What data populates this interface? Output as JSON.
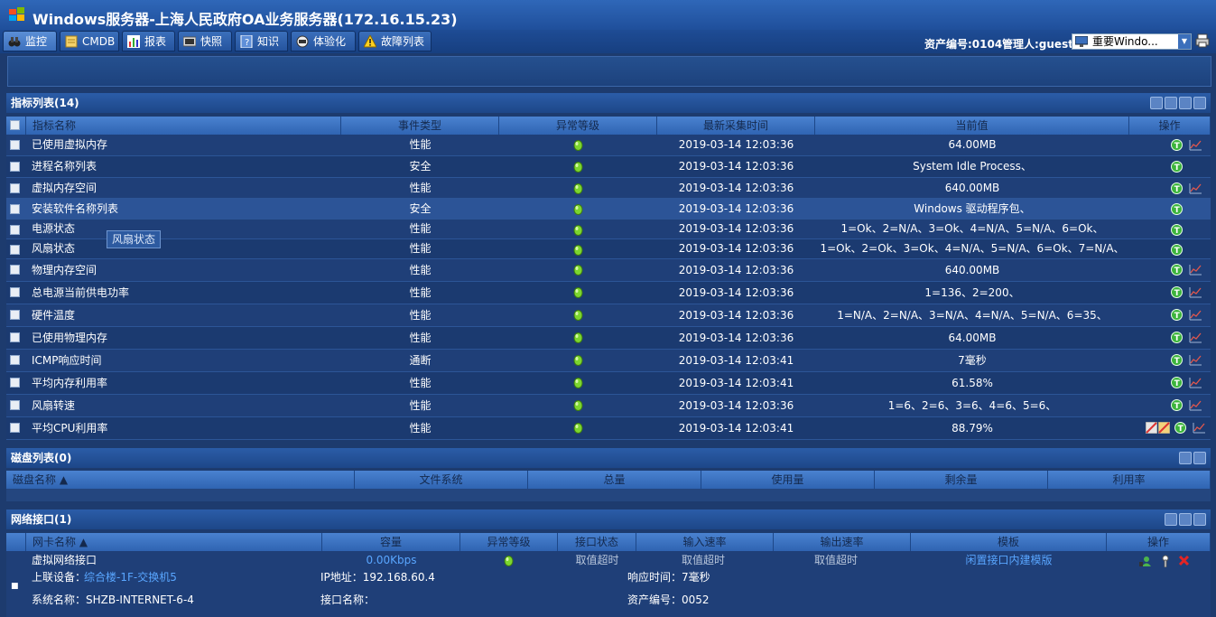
{
  "window": {
    "title": "Windows服务器-上海人民政府OA业务服务器(172.16.15.23)"
  },
  "tabs": [
    {
      "label": "监控",
      "icon": "binoculars-icon",
      "active": true
    },
    {
      "label": "CMDB",
      "icon": "database-icon"
    },
    {
      "label": "报表",
      "icon": "bar-chart-icon"
    },
    {
      "label": "快照",
      "icon": "snapshot-icon"
    },
    {
      "label": "知识",
      "icon": "book-icon"
    },
    {
      "label": "体验化",
      "icon": "globe-icon"
    },
    {
      "label": "故障列表",
      "icon": "warning-icon"
    }
  ],
  "header_meta": {
    "asset_label": "资产编号:0104",
    "manager_label": "管理人:guest",
    "importance_select": "重要Windo..."
  },
  "metrics_panel": {
    "title": "指标列表(14)",
    "columns": [
      "指标名称",
      "事件类型",
      "异常等级",
      "最新采集时间",
      "当前值",
      "操作"
    ],
    "rows": [
      {
        "name": "已使用虚拟内存",
        "type": "性能",
        "time": "2019-03-14 12:03:36",
        "value": "64.00MB",
        "chart": true
      },
      {
        "name": "进程名称列表",
        "type": "安全",
        "time": "2019-03-14 12:03:36",
        "value": "System Idle Process、",
        "chart": false
      },
      {
        "name": "虚拟内存空间",
        "type": "性能",
        "time": "2019-03-14 12:03:36",
        "value": "640.00MB",
        "chart": true
      },
      {
        "name": "安装软件名称列表",
        "type": "安全",
        "time": "2019-03-14 12:03:36",
        "value": "Windows 驱动程序包、",
        "chart": false
      },
      {
        "name": "电源状态",
        "type": "性能",
        "time": "2019-03-14 12:03:36",
        "value": "1=Ok、2=N/A、3=Ok、4=N/A、5=N/A、6=Ok、",
        "chart": false
      },
      {
        "name": "风扇状态",
        "type": "性能",
        "time": "2019-03-14 12:03:36",
        "value": "1=Ok、2=Ok、3=Ok、4=N/A、5=N/A、6=Ok、7=N/A、",
        "chart": false
      },
      {
        "name": "物理内存空间",
        "type": "性能",
        "time": "2019-03-14 12:03:36",
        "value": "640.00MB",
        "chart": true
      },
      {
        "name": "总电源当前供电功率",
        "type": "性能",
        "time": "2019-03-14 12:03:36",
        "value": "1=136、2=200、",
        "chart": true
      },
      {
        "name": "硬件温度",
        "type": "性能",
        "time": "2019-03-14 12:03:36",
        "value": "1=N/A、2=N/A、3=N/A、4=N/A、5=N/A、6=35、",
        "chart": true
      },
      {
        "name": "已使用物理内存",
        "type": "性能",
        "time": "2019-03-14 12:03:36",
        "value": "64.00MB",
        "chart": true
      },
      {
        "name": "ICMP响应时间",
        "type": "通断",
        "time": "2019-03-14 12:03:41",
        "value": "7毫秒",
        "chart": true
      },
      {
        "name": "平均内存利用率",
        "type": "性能",
        "time": "2019-03-14 12:03:41",
        "value": "61.58%",
        "chart": true
      },
      {
        "name": "风扇转速",
        "type": "性能",
        "time": "2019-03-14 12:03:36",
        "value": "1=6、2=6、3=6、4=6、5=6、",
        "chart": true
      },
      {
        "name": "平均CPU利用率",
        "type": "性能",
        "time": "2019-03-14 12:03:41",
        "value": "88.79%",
        "chart": true,
        "extra_icons": true
      }
    ],
    "tooltip": "风扇状态"
  },
  "disk_panel": {
    "title": "磁盘列表(0)",
    "columns": [
      "磁盘名称 ▲",
      "文件系统",
      "总量",
      "使用量",
      "剩余量",
      "利用率"
    ]
  },
  "network_panel": {
    "title": "网络接口(1)",
    "columns": [
      "网卡名称 ▲",
      "容量",
      "异常等级",
      "接口状态",
      "输入速率",
      "输出速率",
      "模板",
      "操作"
    ],
    "row": {
      "name": "虚拟网络接口",
      "capacity": "0.00Kbps",
      "status": "取值超时",
      "input_rate": "取值超时",
      "output_rate": "取值超时",
      "template": "闲置接口内建模版",
      "uplink_label": "上联设备：",
      "uplink_value": "综合楼-1F-交换机5",
      "ip_label": "IP地址：192.168.60.4",
      "response_label": "响应时间：7毫秒",
      "sysname_label": "系统名称：SHZB-INTERNET-6-4",
      "ifname_label": "接口名称：",
      "asset_label": "资产编号：0052"
    }
  },
  "colors": {
    "background": "#1d3b6e",
    "header": "#2b5da8",
    "column_header": "#4a82d0",
    "ok_gem": "#7cd62e",
    "link": "#59a6ff",
    "delete": "#e32424"
  }
}
